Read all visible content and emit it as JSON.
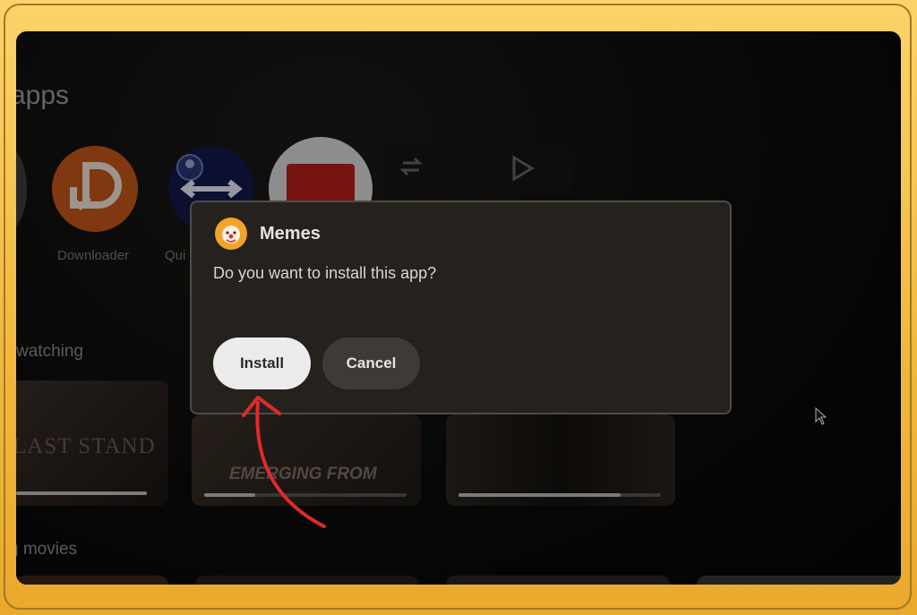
{
  "background": {
    "sections": {
      "apps": "apps",
      "continue_watching": "watching",
      "movies": "g movies"
    },
    "apps": [
      {
        "name": "",
        "icon": "app-icon-partial"
      },
      {
        "name": "Downloader",
        "icon": "downloader-icon"
      },
      {
        "name": "Qui",
        "icon": "quick-share-icon"
      },
      {
        "name": "",
        "icon": "red-app-icon"
      },
      {
        "name": "",
        "icon": "swap-icon"
      },
      {
        "name": "",
        "icon": "play-store-icon"
      }
    ],
    "tiles": [
      {
        "text": "LAST STAND",
        "progress": 1.0
      },
      {
        "text": "EMERGING FROM",
        "progress": 0.25
      },
      {
        "text": "",
        "progress": 0.8
      }
    ]
  },
  "dialog": {
    "app_name": "Memes",
    "question": "Do you want to install this app?",
    "install_label": "Install",
    "cancel_label": "Cancel",
    "icon": "memes-clown-icon"
  },
  "colors": {
    "frame": "#f2b93e",
    "dialog_bg": "#25211d",
    "install_bg": "#ececec",
    "cancel_bg": "#3e3a36",
    "annotation_arrow": "#e02a2a"
  }
}
